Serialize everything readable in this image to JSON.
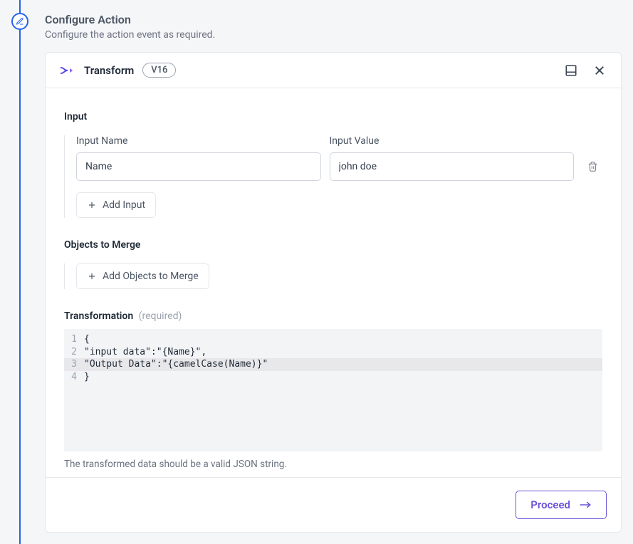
{
  "step": {
    "title": "Configure Action",
    "subtitle": "Configure the action event as required."
  },
  "header": {
    "transform_label": "Transform",
    "version": "V16"
  },
  "input_section": {
    "label": "Input",
    "name_label": "Input Name",
    "value_label": "Input Value",
    "rows": [
      {
        "name": "Name",
        "value": "john doe"
      }
    ],
    "add_label": "Add Input"
  },
  "merge_section": {
    "label": "Objects to Merge",
    "add_label": "Add Objects to Merge"
  },
  "transformation": {
    "label": "Transformation",
    "required_tag": "(required)",
    "lines": [
      "{",
      "\"input data\":\"{Name}\",",
      "\"Output Data\":\"{camelCase(Name)}\"",
      "}"
    ],
    "highlighted_line": 3,
    "hint": "The transformed data should be a valid JSON string."
  },
  "footer": {
    "proceed_label": "Proceed"
  }
}
